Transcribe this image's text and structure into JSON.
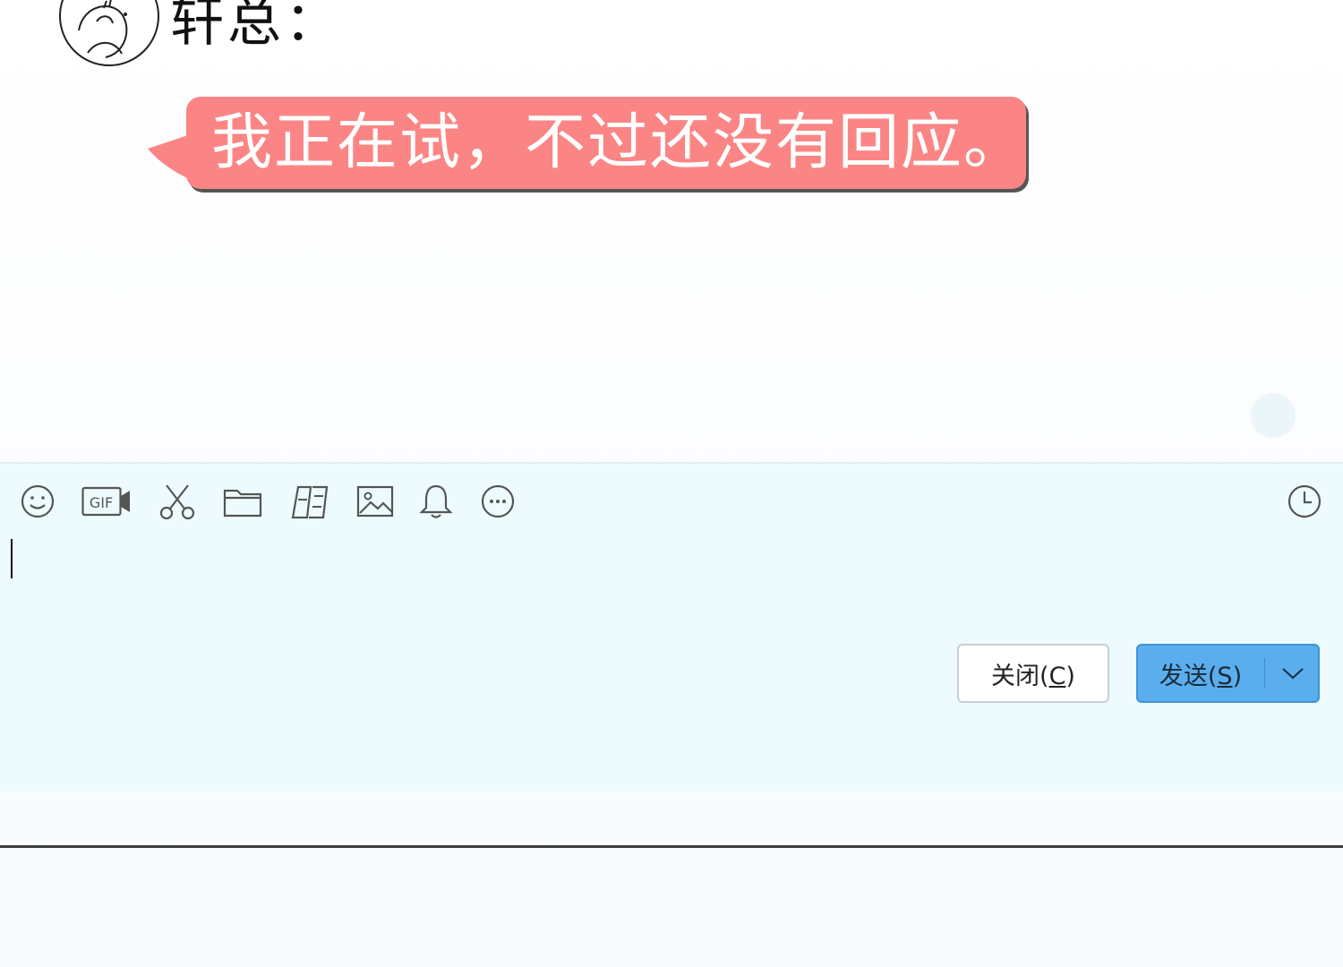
{
  "header": {
    "speaker_name": "轩总："
  },
  "message": {
    "text": "我正在试，不过还没有回应。",
    "bubble_color": "#fb8585"
  },
  "toolbar": {
    "icons": [
      "emoji-icon",
      "gif-icon",
      "scissors-icon",
      "folder-icon",
      "file-transfer-icon",
      "image-icon",
      "bell-icon",
      "more-icon"
    ],
    "gif_label": "GIF",
    "history_icon": "clock-icon"
  },
  "input": {
    "value": ""
  },
  "buttons": {
    "close_prefix": "关闭(",
    "close_key": "C",
    "close_suffix": ")",
    "send_prefix": "发送(",
    "send_key": "S",
    "send_suffix": ")",
    "send_color": "#5aaeee"
  }
}
